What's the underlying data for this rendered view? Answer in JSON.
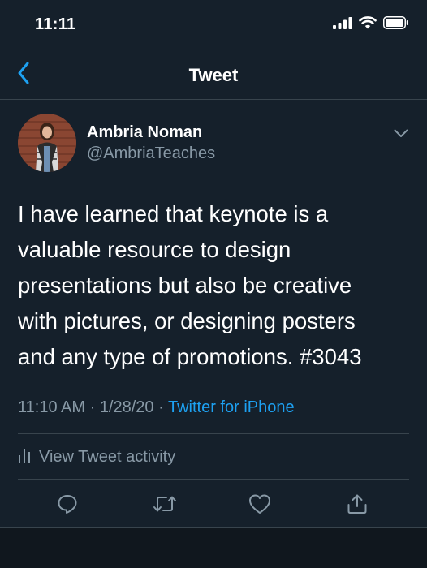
{
  "status_bar": {
    "time": "11:11",
    "icons": [
      "cellular-signal-icon",
      "wifi-icon",
      "battery-icon"
    ]
  },
  "nav": {
    "back_icon": "chevron-left-icon",
    "title": "Tweet"
  },
  "tweet": {
    "author_name": "Ambria Noman",
    "author_handle": "@AmbriaTeaches",
    "text": "I have learned that keynote is a\nvaluable resource to design\npresentations but also be creative\nwith pictures, or designing posters\nand any type of promotions. #3043",
    "time": "11:10 AM",
    "separator": " · ",
    "date": "1/28/20",
    "source": "Twitter for iPhone",
    "activity_label": "View Tweet activity"
  },
  "actions": [
    {
      "name": "reply",
      "icon": "reply-icon"
    },
    {
      "name": "retweet",
      "icon": "retweet-icon"
    },
    {
      "name": "like",
      "icon": "heart-icon"
    },
    {
      "name": "share",
      "icon": "share-icon"
    }
  ],
  "colors": {
    "background": "#15202b",
    "accent": "#1da1f2",
    "secondary_text": "#8899a6",
    "divider": "#38444d"
  }
}
